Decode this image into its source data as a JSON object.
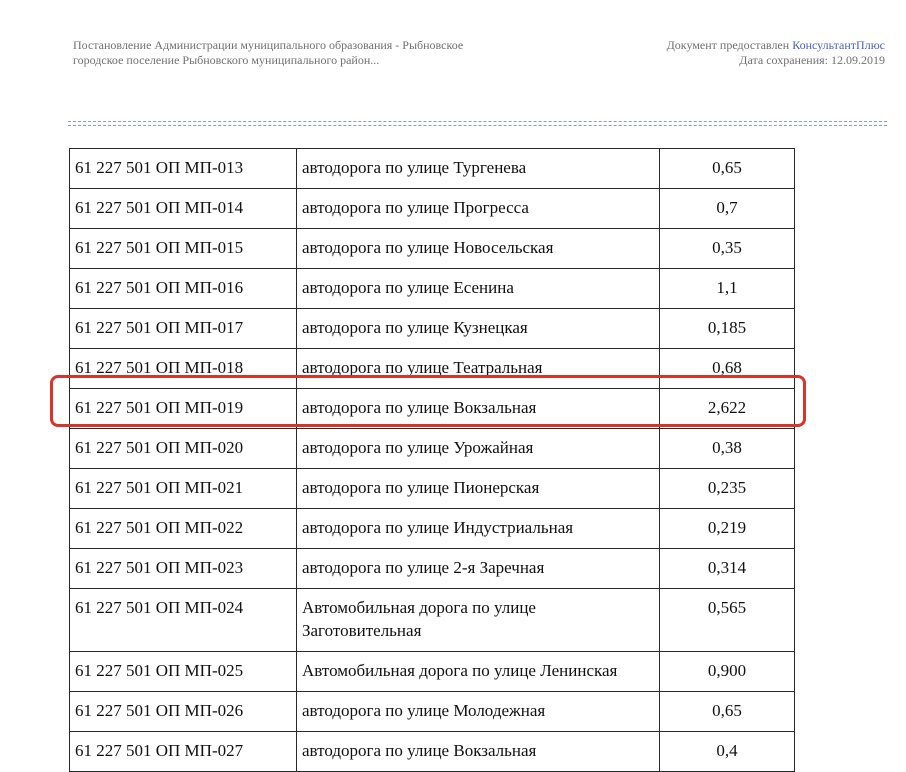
{
  "header": {
    "left_line1": "Постановление Администрации муниципального образования - Рыбновское",
    "left_line2": "городское поселение Рыбновского муниципального район...",
    "provided_label": "Документ предоставлен",
    "brand": "КонсультантПлюс",
    "saved": "Дата сохранения: 12.09.2019"
  },
  "rows": [
    {
      "code": "61 227 501 ОП МП-013",
      "name": "автодорога по улице Тургенева",
      "length": "0,65"
    },
    {
      "code": "61 227 501 ОП МП-014",
      "name": "автодорога по улице Прогресса",
      "length": "0,7"
    },
    {
      "code": "61 227 501 ОП МП-015",
      "name": "автодорога по улице Новосельская",
      "length": "0,35"
    },
    {
      "code": "61 227 501 ОП МП-016",
      "name": "автодорога по улице Есенина",
      "length": "1,1"
    },
    {
      "code": "61 227 501 ОП МП-017",
      "name": "автодорога по улице Кузнецкая",
      "length": "0,185"
    },
    {
      "code": "61 227 501 ОП МП-018",
      "name": "автодорога по улице Театральная",
      "length": "0,68"
    },
    {
      "code": "61 227 501 ОП МП-019",
      "name": "автодорога по улице Вокзальная",
      "length": "2,622"
    },
    {
      "code": "61 227 501 ОП МП-020",
      "name": "автодорога по улице Урожайная",
      "length": "0,38"
    },
    {
      "code": "61 227 501 ОП МП-021",
      "name": "автодорога по улице Пионерская",
      "length": "0,235"
    },
    {
      "code": "61 227 501 ОП МП-022",
      "name": "автодорога по улице Индустриальная",
      "length": "0,219"
    },
    {
      "code": "61 227 501 ОП МП-023",
      "name": "автодорога по улице 2-я Заречная",
      "length": "0,314"
    },
    {
      "code": "61 227 501 ОП МП-024",
      "name": "Автомобильная дорога по улице Заготовительная",
      "length": "0,565"
    },
    {
      "code": "61 227 501 ОП МП-025",
      "name": "Автомобильная дорога по улице Ленинская",
      "length": "0,900"
    },
    {
      "code": "61 227 501 ОП МП-026",
      "name": "автодорога по улице Молодежная",
      "length": "0,65"
    },
    {
      "code": "61 227 501 ОП МП-027",
      "name": "автодорога по улице Вокзальная",
      "length": "0,4"
    }
  ]
}
